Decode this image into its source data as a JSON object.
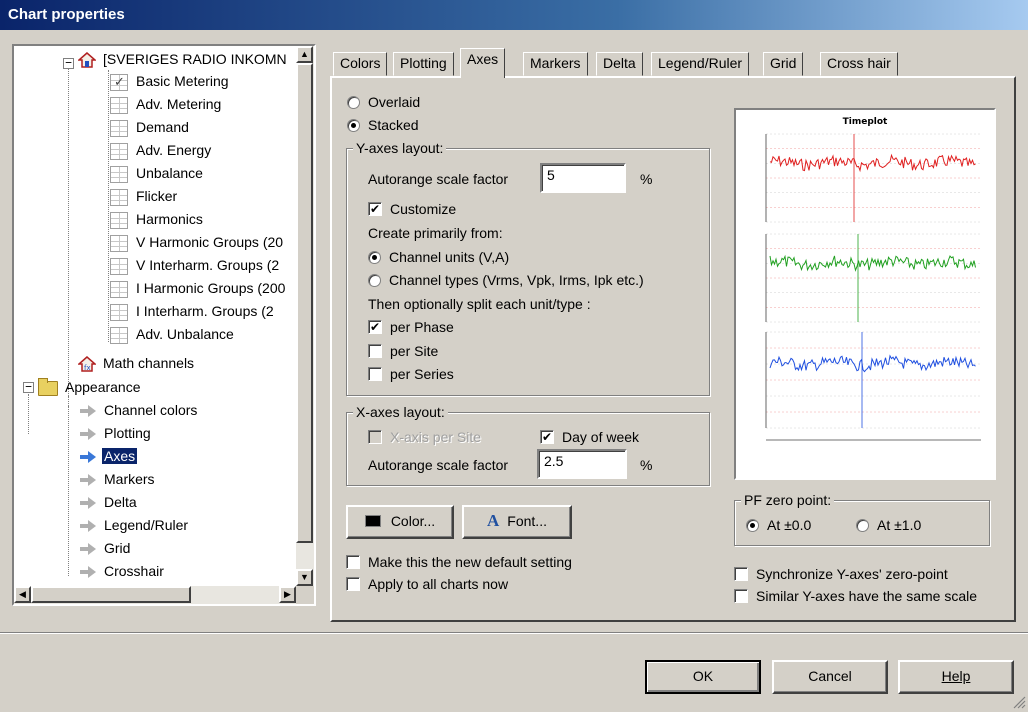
{
  "window": {
    "title": "Chart properties"
  },
  "tree": {
    "site": "[SVERIGES RADIO INKOMN",
    "children": [
      "Basic Metering",
      "Adv. Metering",
      "Demand",
      "Adv. Energy",
      "Unbalance",
      "Flicker",
      "Harmonics",
      "V Harmonic Groups (20",
      "V Interharm. Groups (2",
      "I Harmonic Groups (200",
      "I Interharm. Groups (2",
      "Adv. Unbalance"
    ],
    "math": "Math channels",
    "appearance": "Appearance",
    "appearance_items": [
      "Channel colors",
      "Plotting",
      "Axes",
      "Markers",
      "Delta",
      "Legend/Ruler",
      "Grid",
      "Crosshair"
    ],
    "selected": "Axes"
  },
  "tabs": [
    "Colors",
    "Plotting",
    "Axes",
    "Markers",
    "Delta",
    "Legend/Ruler",
    "Grid",
    "Cross hair"
  ],
  "active_tab": "Axes",
  "mode": {
    "overlaid": "Overlaid",
    "stacked": "Stacked",
    "selected": "Stacked"
  },
  "yaxes": {
    "title": "Y-axes layout:",
    "autorange_label": "Autorange scale factor",
    "autorange_value": "5",
    "percent": "%",
    "customize": "Customize",
    "create_label": "Create primarily from:",
    "channel_units": "Channel units (V,A)",
    "channel_types": "Channel types (Vrms, Vpk, Irms, Ipk etc.)",
    "split_label": "Then optionally split each unit/type :",
    "per_phase": "per Phase",
    "per_site": "per Site",
    "per_series": "per Series"
  },
  "xaxes": {
    "title": "X-axes layout:",
    "per_site": "X-axis per Site",
    "day_of_week": "Day of week",
    "autorange_label": "Autorange scale factor",
    "autorange_value": "2.5",
    "percent": "%"
  },
  "buttons": {
    "color": "Color...",
    "font": "Font...",
    "ok": "OK",
    "cancel": "Cancel",
    "help": "Help"
  },
  "options": {
    "default": "Make this the new default setting",
    "apply_all": "Apply to all charts now",
    "sync_zero": "Synchronize Y-axes' zero-point",
    "same_scale": "Similar Y-axes have the same scale"
  },
  "pf": {
    "title": "PF zero point:",
    "opt1": "At ±0.0",
    "opt2": "At ±1.0"
  },
  "preview": {
    "title": "Timeplot",
    "series_colors": [
      "#e02020",
      "#20a020",
      "#2050e0"
    ]
  }
}
